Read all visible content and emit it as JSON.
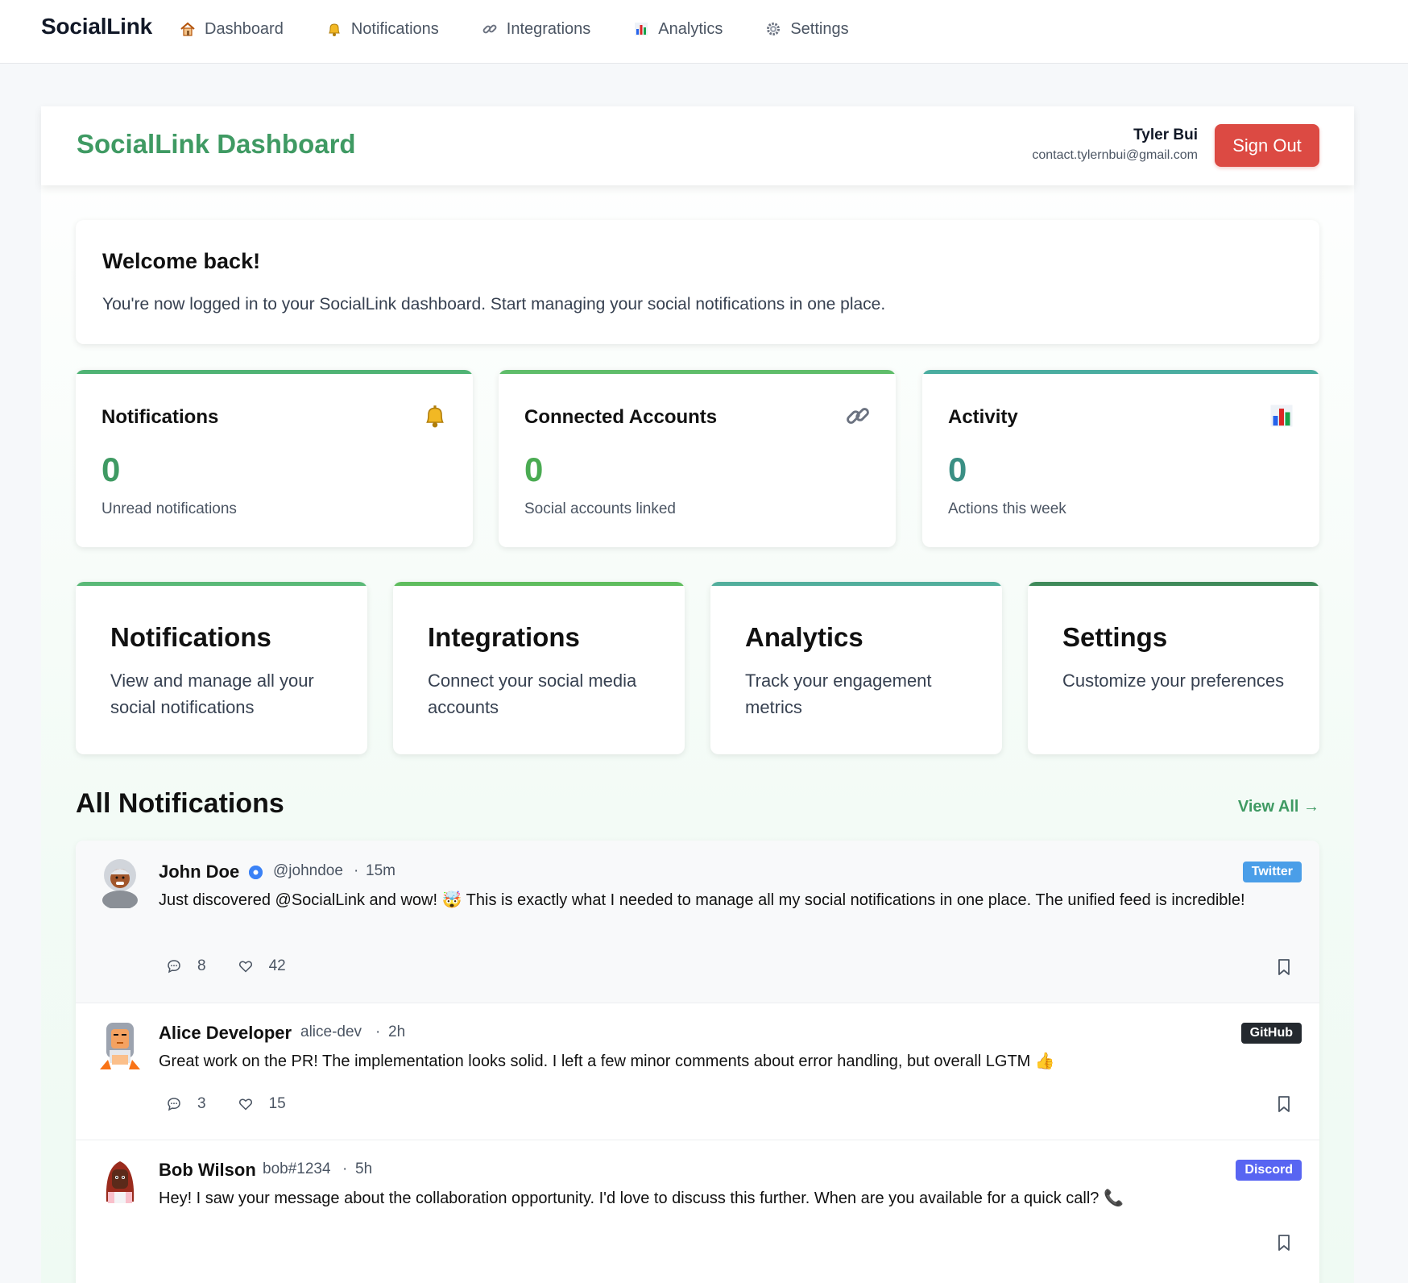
{
  "nav": {
    "brand": "SocialLink",
    "links": [
      {
        "label": "Dashboard",
        "icon": "house-icon"
      },
      {
        "label": "Notifications",
        "icon": "bell-icon"
      },
      {
        "label": "Integrations",
        "icon": "link-icon"
      },
      {
        "label": "Analytics",
        "icon": "bar-chart-icon"
      },
      {
        "label": "Settings",
        "icon": "gear-icon"
      }
    ]
  },
  "header": {
    "title": "SocialLink Dashboard",
    "user_name": "Tyler Bui",
    "user_email": "contact.tylernbui@gmail.com",
    "signout_label": "Sign Out"
  },
  "welcome": {
    "title": "Welcome back!",
    "text": "You're now logged in to your SocialLink dashboard. Start managing your social notifications in one place."
  },
  "stats": [
    {
      "title": "Notifications",
      "value": "0",
      "sub": "Unread notifications",
      "icon": "bell-icon"
    },
    {
      "title": "Connected Accounts",
      "value": "0",
      "sub": "Social accounts linked",
      "icon": "link-icon"
    },
    {
      "title": "Activity",
      "value": "0",
      "sub": "Actions this week",
      "icon": "bar-chart-icon"
    }
  ],
  "features": [
    {
      "title": "Notifications",
      "text": "View and manage all your social notifications"
    },
    {
      "title": "Integrations",
      "text": "Connect your social media accounts"
    },
    {
      "title": "Analytics",
      "text": "Track your engagement metrics"
    },
    {
      "title": "Settings",
      "text": "Customize your preferences"
    }
  ],
  "feed": {
    "title": "All Notifications",
    "view_all": "View All →",
    "posts": [
      {
        "name": "John Doe",
        "handle": "@johndoe",
        "time": "15m",
        "text": "Just discovered @SocialLink and wow! 🤯 This is exactly what I needed to manage all my social notifications in one place. The unified feed is incredible!",
        "platform": "Twitter",
        "comments": "8",
        "likes": "42"
      },
      {
        "name": "Alice Developer",
        "handle": "alice-dev",
        "time": "2h",
        "text": "Great work on the PR! The implementation looks solid. I left a few minor comments about error handling, but overall LGTM 👍",
        "platform": "GitHub",
        "comments": "3",
        "likes": "15"
      },
      {
        "name": "Bob Wilson",
        "handle": "bob#1234",
        "time": "5h",
        "text": "Hey! I saw your message about the collaboration opportunity. I'd love to discuss this further. When are you available for a quick call? 📞",
        "platform": "Discord"
      }
    ]
  },
  "colors": {
    "brand_green": "#3f9a63",
    "signout_red": "#dc4a43",
    "twitter": "#4a9ee8",
    "github": "#24292f",
    "discord": "#5865f2"
  }
}
